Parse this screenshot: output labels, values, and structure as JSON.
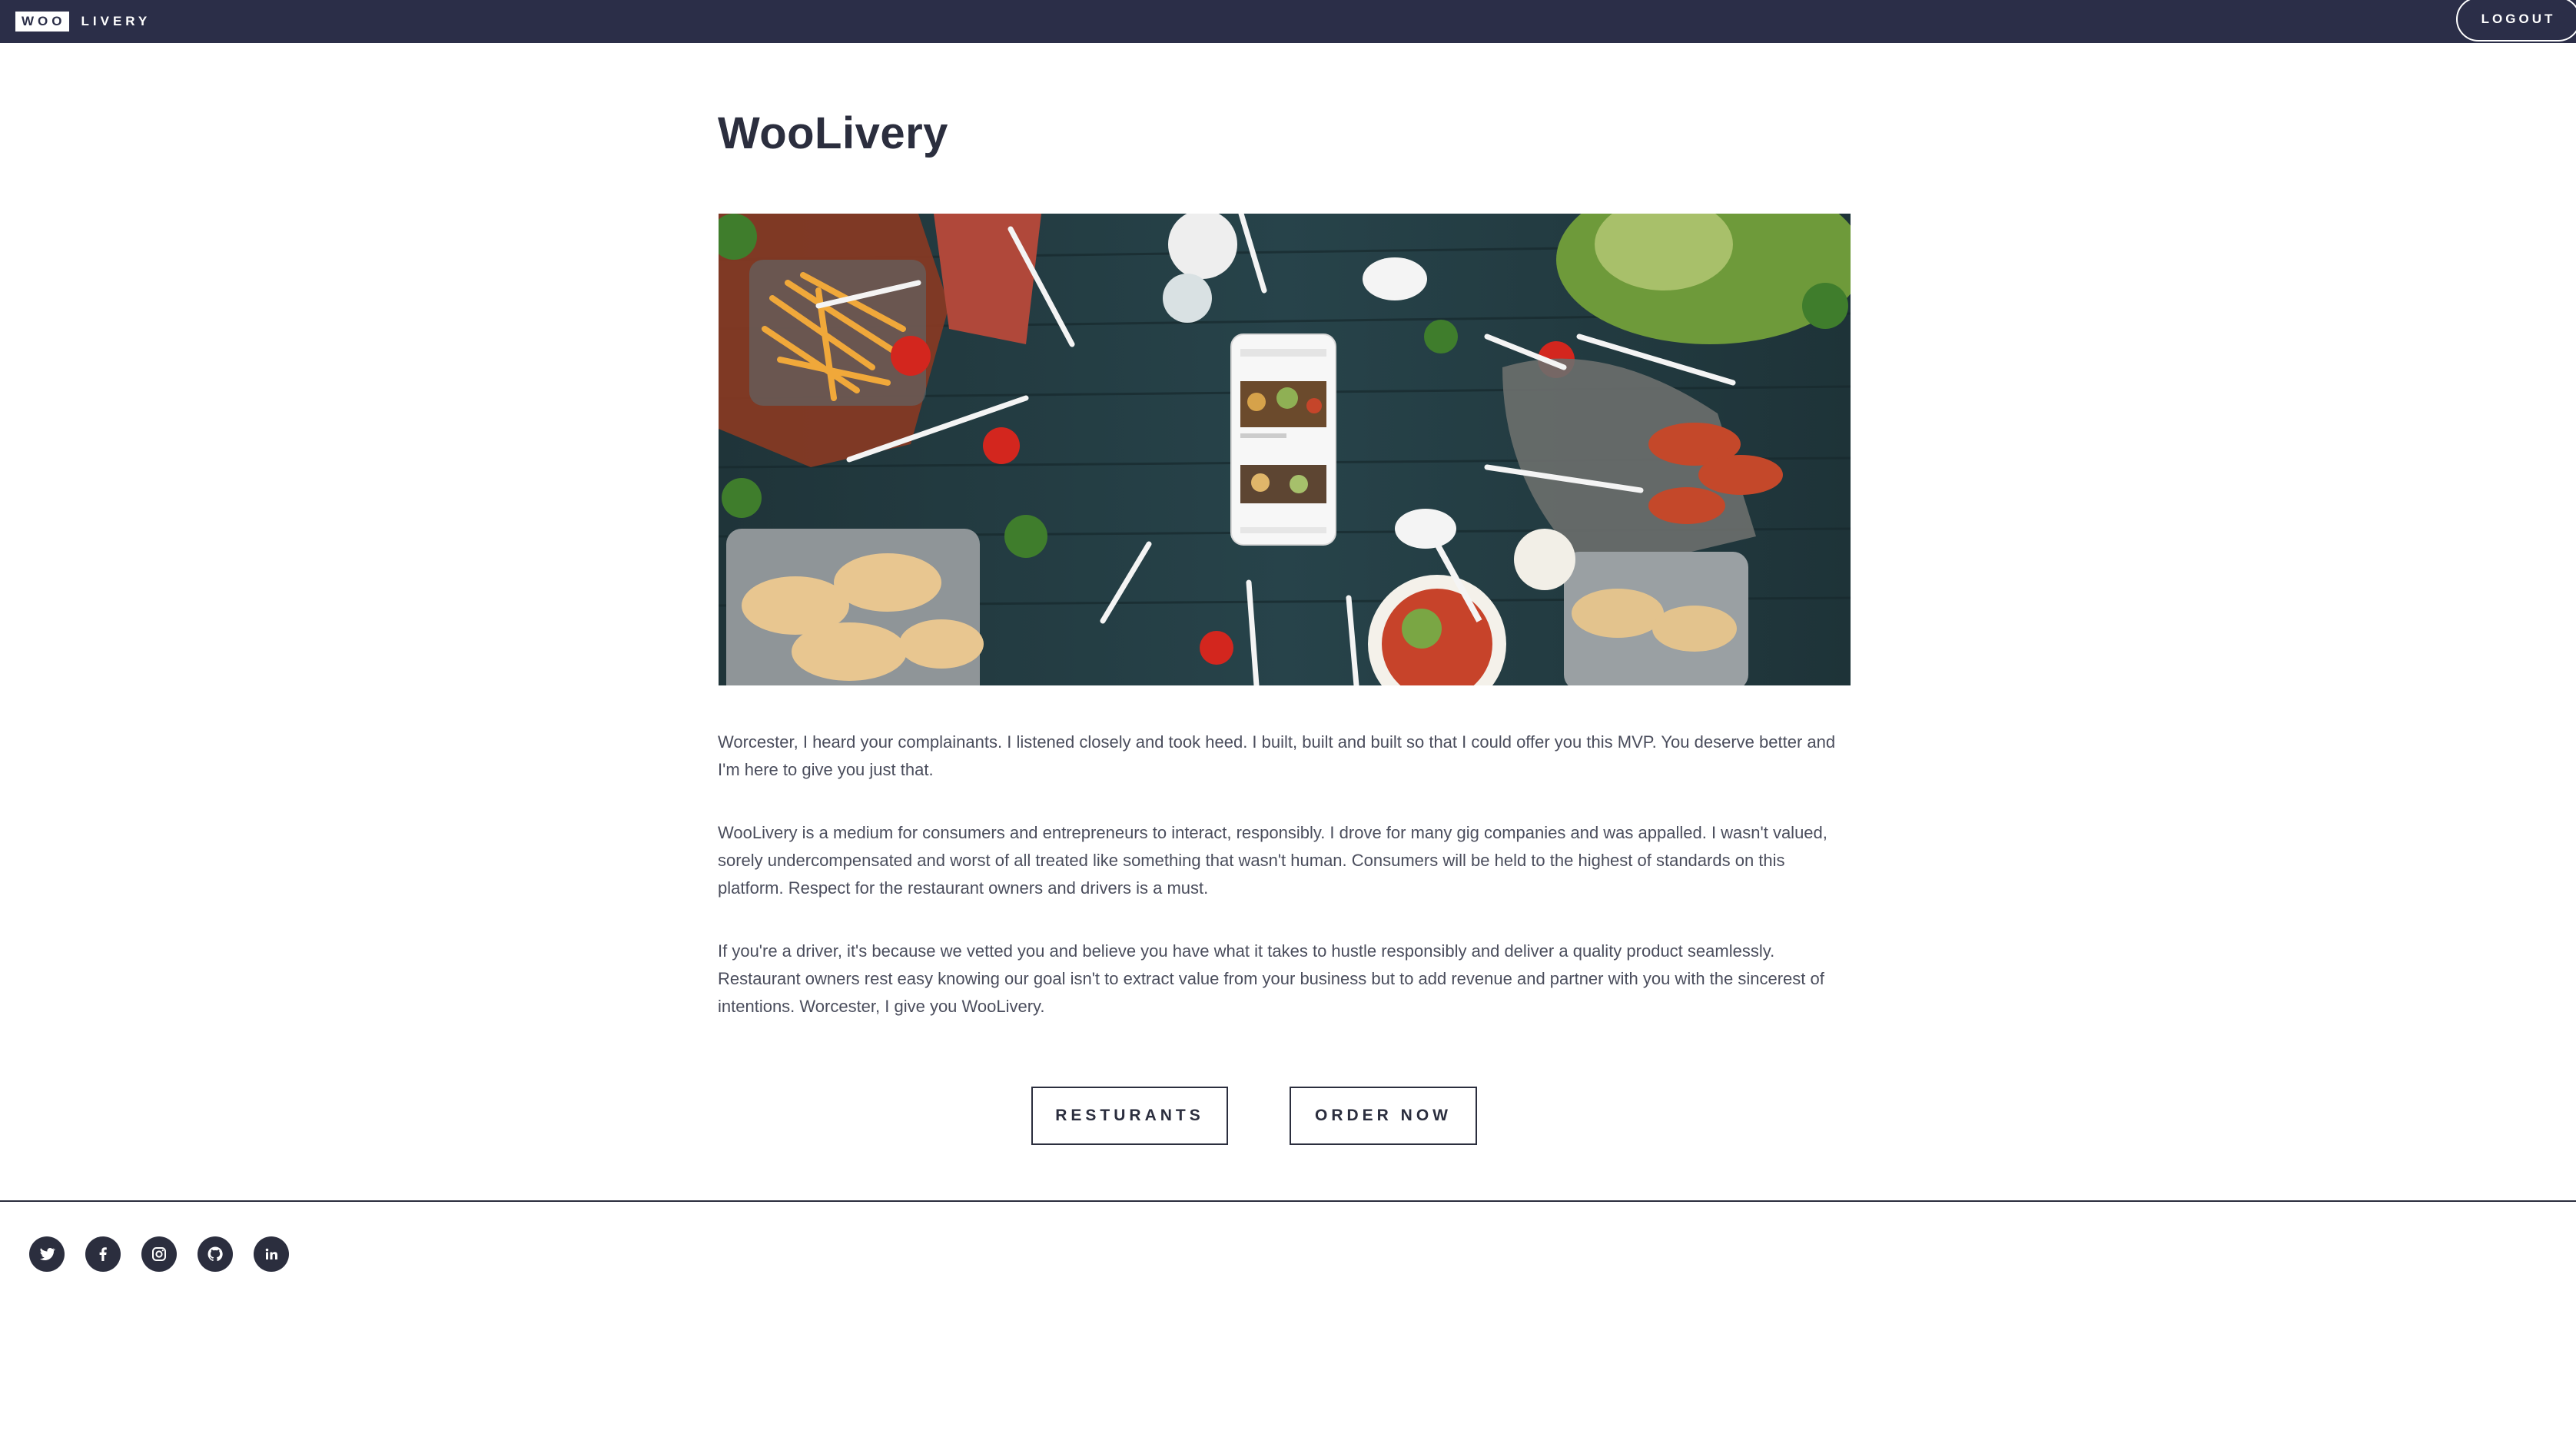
{
  "nav": {
    "brand_box": "WOO",
    "brand_rest": "LIVERY",
    "logout_label": "LOGOUT"
  },
  "main": {
    "title": "WooLivery",
    "hero_alt": "Food delivery spread with phone app",
    "paragraphs": [
      "Worcester, I heard your complainants. I listened closely and took heed. I built, built and built so that I could offer you this MVP. You deserve better and I'm here to give you just that.",
      "WooLivery is a medium for consumers and entrepreneurs to interact, responsibly. I drove for many gig companies and was appalled. I wasn't valued, sorely undercompensated and worst of all treated like something that wasn't human. Consumers will be held to the highest of standards on this platform. Respect for the restaurant owners and drivers is a must.",
      "If you're a driver, it's because we vetted you and believe you have what it takes to hustle responsibly and deliver a quality product seamlessly. Restaurant owners rest easy knowing our goal isn't to extract value from your business but to add revenue and partner with you with the sincerest of intentions. Worcester, I give you WooLivery."
    ],
    "buttons": {
      "restaurants": "RESTURANTS",
      "order_now": "ORDER NOW"
    }
  },
  "footer": {
    "socials": [
      "twitter-icon",
      "facebook-icon",
      "instagram-icon",
      "github-icon",
      "linkedin-icon"
    ]
  },
  "colors": {
    "nav_bg": "#2b2e48",
    "text_dark": "#2b2e3e",
    "body_text": "#4a4d5c"
  }
}
